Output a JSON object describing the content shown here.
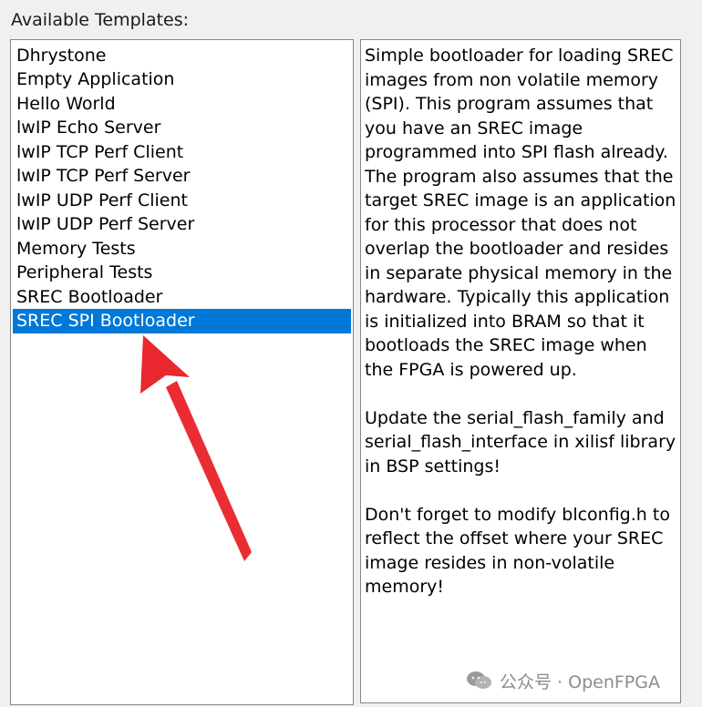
{
  "section_label": "Available Templates:",
  "templates": [
    {
      "label": "Dhrystone",
      "selected": false
    },
    {
      "label": "Empty Application",
      "selected": false
    },
    {
      "label": "Hello World",
      "selected": false
    },
    {
      "label": "lwIP Echo Server",
      "selected": false
    },
    {
      "label": "lwIP TCP Perf Client",
      "selected": false
    },
    {
      "label": "lwIP TCP Perf Server",
      "selected": false
    },
    {
      "label": "lwIP UDP Perf Client",
      "selected": false
    },
    {
      "label": "lwIP UDP Perf Server",
      "selected": false
    },
    {
      "label": "Memory Tests",
      "selected": false
    },
    {
      "label": "Peripheral Tests",
      "selected": false
    },
    {
      "label": "SREC Bootloader",
      "selected": false
    },
    {
      "label": "SREC SPI Bootloader",
      "selected": true
    }
  ],
  "description": "Simple bootloader for loading SREC images from non volatile memory (SPI). This program assumes that you have an SREC image programmed into SPI flash already. The program also assumes that the target SREC image is an application for this processor that does not overlap the bootloader and resides in separate physical memory in the hardware. Typically this application is initialized into BRAM so that it bootloads the SREC image when the FPGA is powered up.\n\nUpdate the serial_flash_family and serial_flash_interface in xilisf library in BSP settings!\n\nDon't forget to modify blconfig.h to reflect the offset where your SREC image resides in non-volatile memory!",
  "watermark": {
    "icon": "wechat-icon",
    "text": "公众号 · OpenFPGA"
  },
  "colors": {
    "selection": "#0078d7",
    "annotation_arrow": "#e8242a"
  }
}
